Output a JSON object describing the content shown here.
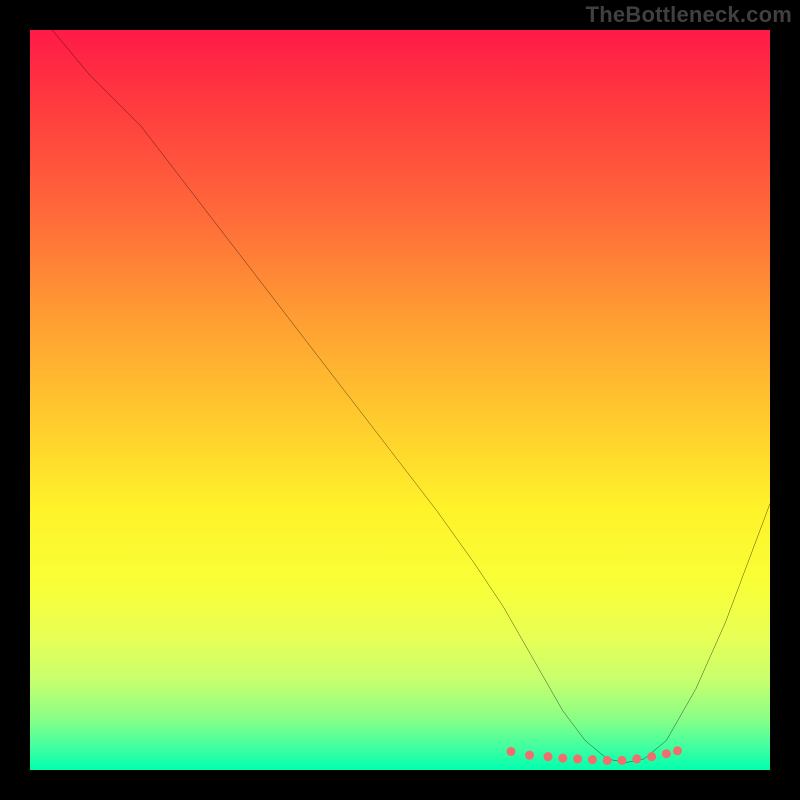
{
  "watermark": "TheBottleneck.com",
  "chart_data": {
    "type": "line",
    "title": "",
    "xlabel": "",
    "ylabel": "",
    "xlim": [
      0,
      100
    ],
    "ylim": [
      0,
      100
    ],
    "grid": false,
    "series": [
      {
        "name": "curve",
        "x": [
          3,
          8,
          15,
          25,
          35,
          45,
          55,
          60,
          64,
          68,
          72,
          75,
          78,
          80.5,
          83,
          86,
          90,
          94,
          100
        ],
        "y": [
          100,
          94,
          87,
          74,
          61,
          48,
          35,
          28,
          22,
          15,
          8,
          4,
          1.5,
          1,
          1.5,
          4,
          11,
          20,
          36
        ],
        "color": "#000000"
      }
    ],
    "markers": {
      "name": "trough-dots",
      "x": [
        65,
        67.5,
        70,
        72,
        74,
        76,
        78,
        80,
        82,
        84,
        86,
        87.5
      ],
      "y": [
        2.5,
        2.0,
        1.8,
        1.6,
        1.5,
        1.4,
        1.3,
        1.3,
        1.5,
        1.8,
        2.2,
        2.6
      ],
      "color": "#f26d6d",
      "size": 9
    },
    "background": {
      "type": "vertical-gradient",
      "stops": [
        {
          "pos": 0.0,
          "color": "#ff1a47"
        },
        {
          "pos": 0.25,
          "color": "#ff6a3a"
        },
        {
          "pos": 0.52,
          "color": "#ffc92e"
        },
        {
          "pos": 0.75,
          "color": "#f8ff37"
        },
        {
          "pos": 0.93,
          "color": "#8aff86"
        },
        {
          "pos": 1.0,
          "color": "#00ffb0"
        }
      ]
    }
  }
}
